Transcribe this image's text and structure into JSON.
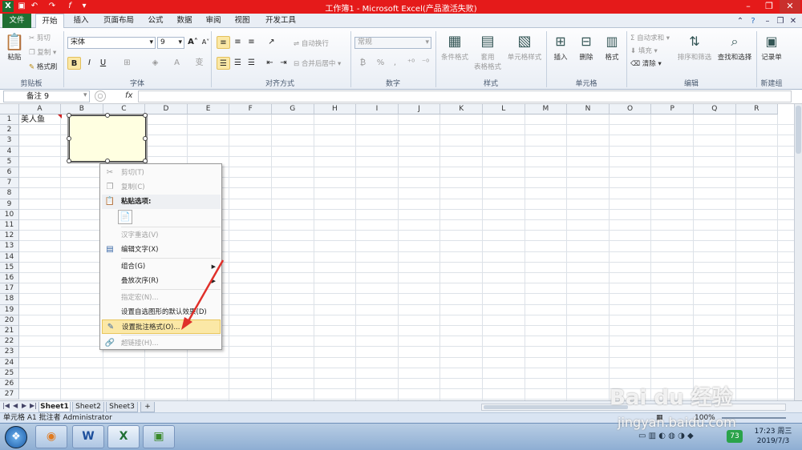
{
  "window": {
    "title": "工作簿1 - Microsoft Excel(产品激活失败)"
  },
  "tabs": [
    {
      "label": "文件"
    },
    {
      "label": "开始"
    },
    {
      "label": "插入"
    },
    {
      "label": "页面布局"
    },
    {
      "label": "公式"
    },
    {
      "label": "数据"
    },
    {
      "label": "审阅"
    },
    {
      "label": "视图"
    },
    {
      "label": "开发工具"
    }
  ],
  "ribbon": {
    "clipboard": {
      "paste": "粘贴",
      "cut": "剪切",
      "copy": "复制",
      "format_painter": "格式刷",
      "label": "剪贴板"
    },
    "font": {
      "name": "宋体",
      "size": "9",
      "bold": "B",
      "italic": "I",
      "underline": "U",
      "grow": "A",
      "shrink": "A",
      "label": "字体"
    },
    "alignment": {
      "wrap": "自动换行",
      "merge": "合并后居中",
      "label": "对齐方式"
    },
    "number": {
      "format": "常规",
      "percent": "%",
      "comma": ",",
      "label": "数字"
    },
    "styles": {
      "conditional": "条件格式",
      "table_line1": "套用",
      "table_line2": "表格格式",
      "cell_styles": "单元格样式",
      "label": "样式"
    },
    "cells": {
      "insert": "插入",
      "delete": "删除",
      "format": "格式",
      "label": "单元格"
    },
    "editing": {
      "autosum": "自动求和",
      "fill": "填充",
      "clear": "清除",
      "sort": "排序和筛选",
      "find": "查找和选择",
      "label": "编辑"
    },
    "new_group": {
      "record": "记录单",
      "label": "新建组"
    }
  },
  "formula_bar": {
    "name_box": "备注 9",
    "fx": "fx",
    "value": ""
  },
  "columns": [
    "A",
    "B",
    "C",
    "D",
    "E",
    "F",
    "G",
    "H",
    "I",
    "J",
    "K",
    "L",
    "M",
    "N",
    "O",
    "P",
    "Q",
    "R"
  ],
  "rows": [
    "1",
    "2",
    "3",
    "4",
    "5",
    "6",
    "7",
    "8",
    "9",
    "10",
    "11",
    "12",
    "13",
    "14",
    "15",
    "16",
    "17",
    "18",
    "19",
    "20",
    "21",
    "22",
    "23",
    "24",
    "25",
    "26",
    "27"
  ],
  "cells": {
    "A1": "美人鱼"
  },
  "context_menu": {
    "items": [
      {
        "label": "剪切(T)",
        "enabled": false,
        "icon": "scissors-icon"
      },
      {
        "label": "复制(C)",
        "enabled": false,
        "icon": "copy-icon"
      },
      {
        "label": "粘贴选项:",
        "enabled": true,
        "icon": "clipboard-icon",
        "bold": true
      },
      {
        "label": "汉字重选(V)",
        "enabled": false
      },
      {
        "label": "编辑文字(X)",
        "enabled": true,
        "icon": "edit-text-icon"
      },
      {
        "label": "组合(G)",
        "enabled": true,
        "submenu": true
      },
      {
        "label": "叠放次序(R)",
        "enabled": true,
        "submenu": true
      },
      {
        "label": "指定宏(N)...",
        "enabled": false
      },
      {
        "label": "设置自选图形的默认效果(D)",
        "enabled": true
      },
      {
        "label": "设置批注格式(O)...",
        "enabled": true,
        "icon": "format-comment-icon",
        "highlighted": true
      },
      {
        "label": "超链接(H)...",
        "enabled": false,
        "icon": "hyperlink-icon"
      }
    ]
  },
  "sheet_tabs": [
    "Sheet1",
    "Sheet2",
    "Sheet3"
  ],
  "status": {
    "text": "单元格 A1 批注者 Administrator",
    "zoom": "100%"
  },
  "clock": {
    "time": "17:23 周三",
    "date": "2019/7/3"
  },
  "tray": {
    "badge": "73"
  },
  "watermark": {
    "line1": "Bai du 经验",
    "line2": "jingyan.baidu.com"
  },
  "colors": {
    "title_bar": "#e51a1a",
    "file_tab": "#1f6f33",
    "comment_bg": "#ffffe1",
    "highlight": "#fbe8a6",
    "arrow": "#e0302a"
  }
}
